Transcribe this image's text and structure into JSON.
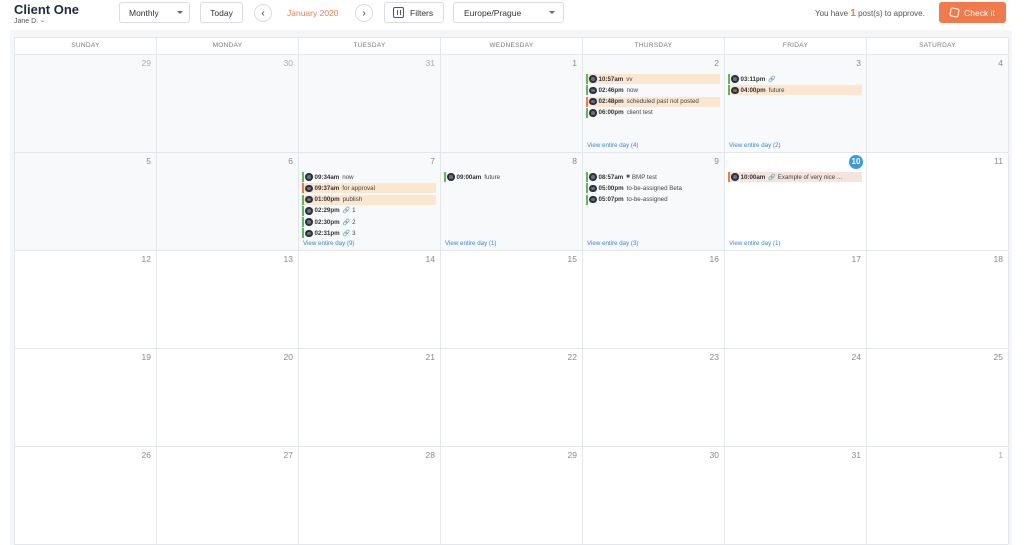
{
  "client": {
    "name": "Client One",
    "user": "Jane D."
  },
  "toolbar": {
    "view_mode": "Monthly",
    "today_label": "Today",
    "month_label": "January 2020",
    "filters_label": "Filters",
    "timezone": "Europe/Prague",
    "approve_prefix": "You have",
    "approve_count": "1",
    "approve_suffix": "post(s) to approve.",
    "check_label": "Check it"
  },
  "colors": {
    "accent": "#f07a4b",
    "link": "#3b86d6",
    "today": "#3b9ae1",
    "published": "#5cb85c"
  },
  "weekdays": [
    "SUNDAY",
    "MONDAY",
    "TUESDAY",
    "WEDNESDAY",
    "THURSDAY",
    "FRIDAY",
    "SATURDAY"
  ],
  "weeks": [
    [
      {
        "num": "29",
        "other": true,
        "past": true
      },
      {
        "num": "30",
        "other": true,
        "past": true
      },
      {
        "num": "31",
        "other": true,
        "past": true
      },
      {
        "num": "1",
        "past": true
      },
      {
        "num": "2",
        "past": true,
        "events": [
          {
            "time": "10:57am",
            "text": "vv",
            "bar": "green",
            "bg": "peach"
          },
          {
            "time": "02:46pm",
            "text": "now",
            "bar": "green"
          },
          {
            "time": "02:48pm",
            "text": "scheduled past not posted",
            "bar": "orange",
            "bg": "peach"
          },
          {
            "time": "06:00pm",
            "text": "client test",
            "bar": "green"
          }
        ],
        "view_all": "View entire day (4)"
      },
      {
        "num": "3",
        "past": true,
        "events": [
          {
            "time": "03:11pm",
            "text": "",
            "icon": "🔗",
            "bar": "green"
          },
          {
            "time": "04:00pm",
            "text": "future",
            "bar": "green",
            "bg": "peach"
          }
        ],
        "view_all": "View entire day (2)"
      },
      {
        "num": "4",
        "past": true
      }
    ],
    [
      {
        "num": "5",
        "past": true
      },
      {
        "num": "6",
        "past": true
      },
      {
        "num": "7",
        "past": true,
        "events": [
          {
            "time": "09:34am",
            "text": "now",
            "bar": "green"
          },
          {
            "time": "09:37am",
            "text": "for approval",
            "bar": "orange",
            "bg": "peach"
          },
          {
            "time": "01:00pm",
            "text": "publish",
            "bar": "green",
            "bg": "peach"
          },
          {
            "time": "02:29pm",
            "text": "1",
            "icon": "🔗",
            "bar": "green"
          },
          {
            "time": "02:30pm",
            "text": "2",
            "icon": "🔗",
            "bar": "green"
          },
          {
            "time": "02:31pm",
            "text": "3",
            "icon": "🔗",
            "bar": "green"
          }
        ],
        "view_all": "View entire day (9)"
      },
      {
        "num": "8",
        "past": true,
        "events": [
          {
            "time": "09:00am",
            "text": "future",
            "bar": "green"
          }
        ],
        "view_all": "View entire day (1)"
      },
      {
        "num": "9",
        "past": true,
        "events": [
          {
            "time": "08:57am",
            "text": "BMP test",
            "icon": "■",
            "bar": "green"
          },
          {
            "time": "05:00pm",
            "text": "to-be-assigned Beta",
            "bar": "green"
          },
          {
            "time": "05:07pm",
            "text": "to-be-assigned",
            "bar": "green"
          }
        ],
        "view_all": "View entire day (3)"
      },
      {
        "num": "10",
        "today": true,
        "events": [
          {
            "time": "10:00am",
            "text": "Example of very nice ...",
            "icon": "🔗",
            "bar": "orange",
            "bg": "pink"
          }
        ],
        "view_all": "View entire day (1)"
      },
      {
        "num": "11"
      }
    ],
    [
      {
        "num": "12"
      },
      {
        "num": "13"
      },
      {
        "num": "14"
      },
      {
        "num": "15"
      },
      {
        "num": "16"
      },
      {
        "num": "17"
      },
      {
        "num": "18"
      }
    ],
    [
      {
        "num": "19"
      },
      {
        "num": "20"
      },
      {
        "num": "21"
      },
      {
        "num": "22"
      },
      {
        "num": "23"
      },
      {
        "num": "24"
      },
      {
        "num": "25"
      }
    ],
    [
      {
        "num": "26"
      },
      {
        "num": "27"
      },
      {
        "num": "28"
      },
      {
        "num": "29"
      },
      {
        "num": "30"
      },
      {
        "num": "31"
      },
      {
        "num": "1",
        "other": true
      }
    ]
  ]
}
